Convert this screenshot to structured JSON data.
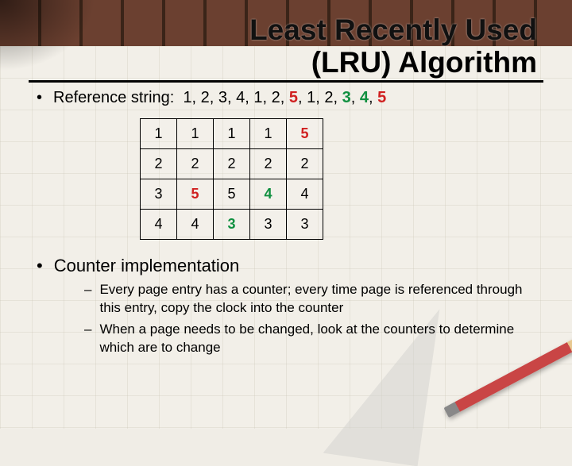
{
  "title": {
    "line1": "Least Recently Used",
    "line2": "(LRU) Algorithm"
  },
  "ref": {
    "label": "Reference string:  ",
    "parts": [
      "1, 2, 3, 4, 1, 2, ",
      "5",
      ", 1, 2, ",
      "3",
      ", ",
      "4",
      ", ",
      "5"
    ]
  },
  "table": {
    "rows": [
      [
        {
          "v": "1"
        },
        {
          "v": "1"
        },
        {
          "v": "1"
        },
        {
          "v": "1"
        },
        {
          "v": "5",
          "c": "red"
        }
      ],
      [
        {
          "v": "2"
        },
        {
          "v": "2"
        },
        {
          "v": "2"
        },
        {
          "v": "2"
        },
        {
          "v": "2"
        }
      ],
      [
        {
          "v": "3"
        },
        {
          "v": "5",
          "c": "red"
        },
        {
          "v": "5"
        },
        {
          "v": "4",
          "c": "green"
        },
        {
          "v": "4"
        }
      ],
      [
        {
          "v": "4"
        },
        {
          "v": "4"
        },
        {
          "v": "3",
          "c": "green"
        },
        {
          "v": "3"
        },
        {
          "v": "3"
        }
      ]
    ]
  },
  "counter": {
    "heading": "Counter implementation",
    "items": [
      "Every page entry has a counter; every time page is referenced through this entry, copy the clock into the counter",
      "When a page needs to be changed, look at the counters to determine which are to change"
    ]
  }
}
